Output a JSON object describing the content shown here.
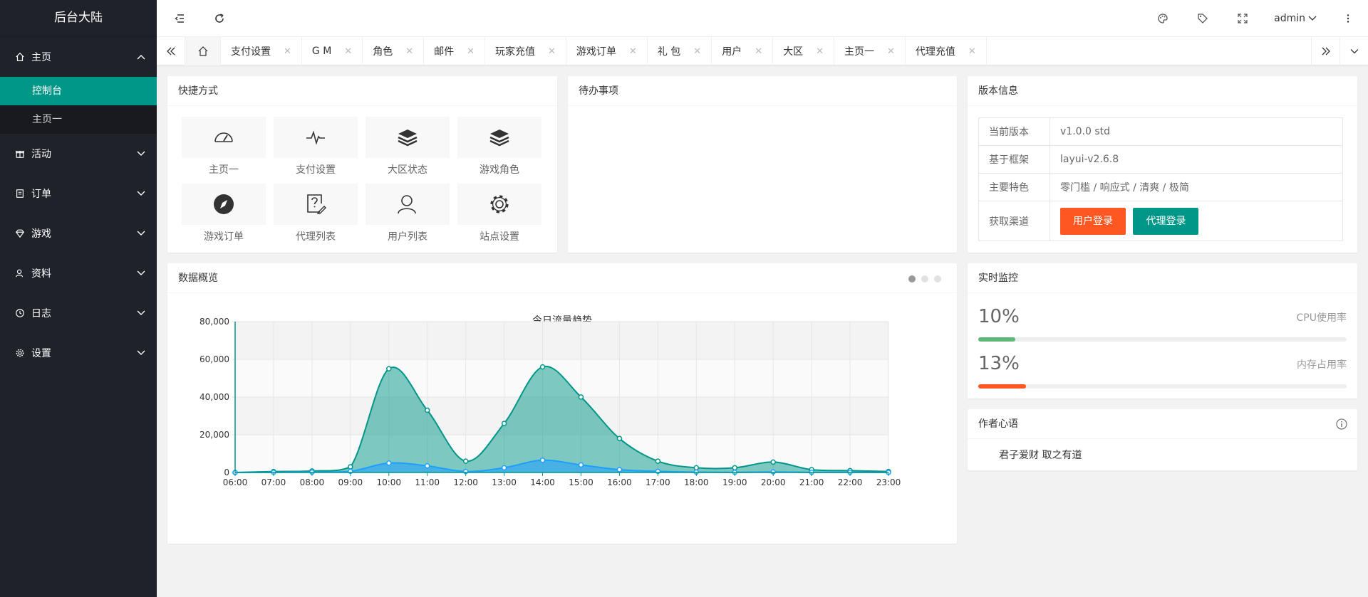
{
  "app": {
    "title": "后台大陆"
  },
  "sidebar": {
    "items": [
      {
        "label": "主页",
        "icon": "home-icon",
        "expanded": true,
        "children": [
          {
            "label": "控制台",
            "active": true
          },
          {
            "label": "主页一",
            "active": false
          }
        ]
      },
      {
        "label": "活动",
        "icon": "gift-icon"
      },
      {
        "label": "订单",
        "icon": "order-icon"
      },
      {
        "label": "游戏",
        "icon": "diamond-icon"
      },
      {
        "label": "资料",
        "icon": "user-icon"
      },
      {
        "label": "日志",
        "icon": "clock-icon"
      },
      {
        "label": "设置",
        "icon": "gear-icon"
      }
    ]
  },
  "header": {
    "user": "admin"
  },
  "tabs": [
    "支付设置",
    "G M",
    "角色",
    "邮件",
    "玩家充值",
    "游戏订单",
    "礼 包",
    "用户",
    "大区",
    "主页一",
    "代理充值"
  ],
  "quick": {
    "title": "快捷方式",
    "items": [
      {
        "label": "主页一",
        "icon": "dashboard-icon"
      },
      {
        "label": "支付设置",
        "icon": "pulse-icon"
      },
      {
        "label": "大区状态",
        "icon": "layers-icon"
      },
      {
        "label": "游戏角色",
        "icon": "layers-icon"
      },
      {
        "label": "游戏订单",
        "icon": "compass-icon"
      },
      {
        "label": "代理列表",
        "icon": "help-doc-icon"
      },
      {
        "label": "用户列表",
        "icon": "user-outline-icon"
      },
      {
        "label": "站点设置",
        "icon": "gear-outline-icon"
      }
    ]
  },
  "todo": {
    "title": "待办事项"
  },
  "version": {
    "title": "版本信息",
    "rows": [
      {
        "k": "当前版本",
        "v": "v1.0.0 std"
      },
      {
        "k": "基于框架",
        "v": "layui-v2.6.8"
      },
      {
        "k": "主要特色",
        "v": "零门槛 / 响应式 / 清爽 / 极简"
      },
      {
        "k": "获取渠道"
      }
    ],
    "btn_user": "用户登录",
    "btn_agent": "代理登录"
  },
  "overview": {
    "title": "数据概览"
  },
  "monitor": {
    "title": "实时监控",
    "cpu": {
      "value": "10%",
      "label": "CPU使用率",
      "percent": 10,
      "color": "#5fb878"
    },
    "mem": {
      "value": "13%",
      "label": "内存占用率",
      "percent": 13,
      "color": "#ff5722"
    }
  },
  "author": {
    "title": "作者心语",
    "text": "君子爱财 取之有道"
  },
  "chart_data": {
    "type": "area",
    "title": "今日流量趋势",
    "x": [
      "06:00",
      "07:00",
      "08:00",
      "09:00",
      "10:00",
      "11:00",
      "12:00",
      "13:00",
      "14:00",
      "15:00",
      "16:00",
      "17:00",
      "18:00",
      "19:00",
      "20:00",
      "21:00",
      "22:00",
      "23:00"
    ],
    "ylim": [
      0,
      80000
    ],
    "yticks": [
      0,
      20000,
      40000,
      60000,
      80000
    ],
    "ytick_labels": [
      "0",
      "20,000",
      "40,000",
      "60,000",
      "80,000"
    ],
    "series": [
      {
        "values": [
          0,
          500,
          800,
          3000,
          55000,
          33000,
          6000,
          26000,
          56000,
          40000,
          18000,
          6000,
          2500,
          2500,
          5500,
          1500,
          1000,
          500
        ],
        "color": "#009688"
      },
      {
        "values": [
          0,
          100,
          200,
          600,
          5000,
          3500,
          500,
          2500,
          6500,
          4000,
          1500,
          600,
          200,
          100,
          300,
          100,
          100,
          50
        ],
        "color": "#1e9fff"
      }
    ]
  }
}
